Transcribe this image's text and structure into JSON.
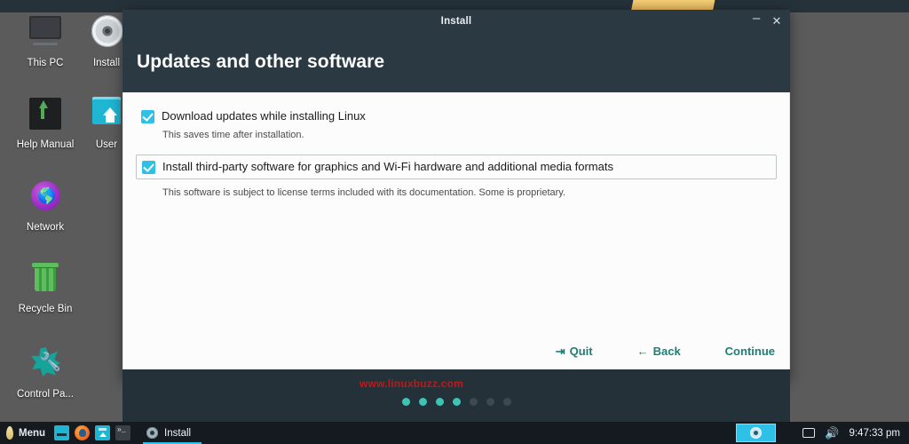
{
  "desktop": {
    "icons": [
      {
        "label": "This PC",
        "icon": "monitor-icon"
      },
      {
        "label": "Install",
        "icon": "disc-icon"
      },
      {
        "label": "Help Manual",
        "icon": "map-icon"
      },
      {
        "label": "User",
        "icon": "home-folder-icon"
      },
      {
        "label": "Network",
        "icon": "globe-icon"
      },
      {
        "label": "Recycle Bin",
        "icon": "trash-icon"
      },
      {
        "label": "Control Pa...",
        "icon": "wrench-icon"
      }
    ]
  },
  "installer": {
    "window_title": "Install",
    "minimize_label": "–",
    "close_label": "✕",
    "heading": "Updates and other software",
    "options": [
      {
        "label": "Download updates while installing Linux",
        "help": "This saves time after installation.",
        "checked": true,
        "focused": false
      },
      {
        "label": "Install third-party software for graphics and Wi-Fi hardware and additional media formats",
        "help": "This software is subject to license terms included with its documentation. Some is proprietary.",
        "checked": true,
        "focused": true
      }
    ],
    "watermark": "www.linuxbuzz.com",
    "actions": {
      "quit": {
        "label": "Quit",
        "icon": "exit-icon",
        "glyph": "⇥"
      },
      "back": {
        "label": "Back",
        "icon": "arrow-left-icon",
        "glyph": "←"
      },
      "continue": {
        "label": "Continue"
      }
    },
    "progress": {
      "total": 7,
      "active": 4
    },
    "colors": {
      "header_bg": "#2b3a42",
      "footer_bg": "#253138",
      "accent_link": "#1d7f74",
      "checkbox": "#2fc0e8",
      "dot_active": "#3ec4b4",
      "watermark": "#b71c1c"
    }
  },
  "taskbar": {
    "menu": {
      "label": "Menu",
      "icon": "menu-logo-icon"
    },
    "quick_launch": [
      {
        "icon": "terminal-icon"
      },
      {
        "icon": "firefox-icon"
      },
      {
        "icon": "file-manager-icon"
      },
      {
        "icon": "shell-icon"
      }
    ],
    "tasks": [
      {
        "label": "Install",
        "icon": "disc-icon",
        "active": true
      }
    ],
    "tray": {
      "window_task_icon": "disc-icon",
      "display_icon": "display-icon",
      "volume_icon": "volume-icon",
      "volume_glyph": "🔊",
      "clock": "9:47:33 pm"
    }
  }
}
